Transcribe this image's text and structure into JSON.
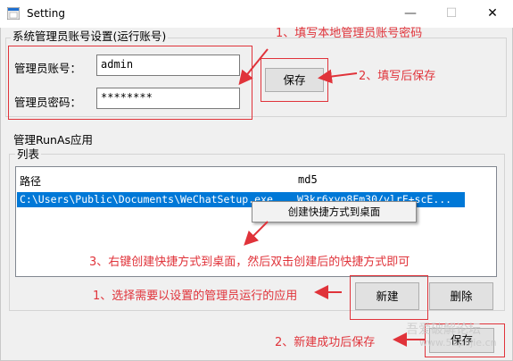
{
  "window": {
    "title": "Setting",
    "minimize_glyph": "—",
    "maximize_glyph": "☐",
    "close_glyph": "✕"
  },
  "admin_group": {
    "title": "系统管理员账号设置(运行账号)",
    "account_label": "管理员账号：",
    "account_value": "admin",
    "password_label": "管理员密码：",
    "password_value": "********",
    "save_label": "保存"
  },
  "runas_group": {
    "title": "管理RunAs应用",
    "list_title": "列表",
    "columns": [
      "路径",
      "md5"
    ],
    "rows": [
      {
        "path": "C:\\Users\\Public\\Documents\\WeChatSetup.exe",
        "md5": "W3kr6xyp8Fm30/ylrF+scE..."
      }
    ],
    "context_menu": [
      "创建快捷方式到桌面"
    ],
    "new_label": "新建",
    "delete_label": "删除",
    "save_label": "保存"
  },
  "annotations": {
    "step1_top": "1、填写本地管理员账号密码",
    "step2_top": "2、填写后保存",
    "step3": "3、右键创建快捷方式到桌面，然后双击创建后的快捷方式即可",
    "step1_bottom": "1、选择需要以设置的管理员运行的应用",
    "step2_bottom": "2、新建成功后保存"
  },
  "watermark": {
    "line1": "吾爱破解论坛",
    "line2": "www.52pojie.cn"
  },
  "colors": {
    "annotation_red": "#e0333a",
    "selection_blue": "#0078d7"
  }
}
